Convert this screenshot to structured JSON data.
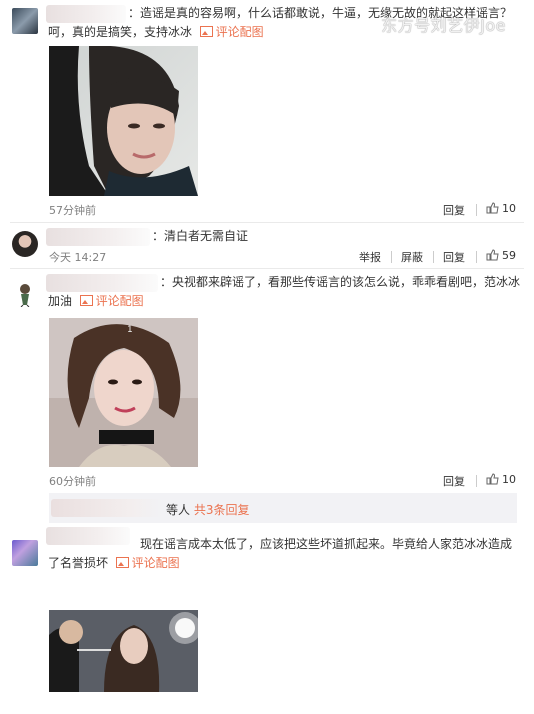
{
  "watermark": "东方号刘艺伊Joe",
  "comments": [
    {
      "text_line1": "：造谣是真的容易啊，什么话都敢说，牛逼，无缘无故的就起这样谣言？",
      "text_line2": "呵，真的是搞笑，支持冰冰",
      "pic_label": "评论配图",
      "time": "57分钟前",
      "reply": "回复",
      "likes": "10"
    },
    {
      "text": "：清白者无需自证",
      "time": "今天 14:27",
      "report": "举报",
      "block": "屏蔽",
      "reply": "回复",
      "likes": "59"
    },
    {
      "text_line1": "：央视都来辟谣了，看那些传谣言的该怎么说，乖乖看剧吧，范冰冰",
      "text_line2": "加油",
      "pic_label": "评论配图",
      "photo_mark": "1",
      "time": "60分钟前",
      "reply": "回复",
      "likes": "10",
      "more_suffix": "等人",
      "more_link": "共3条回复"
    },
    {
      "text_line1": "现在谣言成本太低了，应该把这些坏道抓起来。毕竟给人家范冰冰造成",
      "text_line2": "了名誉损坏",
      "pic_label": "评论配图"
    }
  ],
  "icons": {
    "thumb": "thumbs-up-icon",
    "picture": "picture-icon"
  },
  "colors": {
    "link": "#eb7350",
    "meta": "#808080"
  }
}
